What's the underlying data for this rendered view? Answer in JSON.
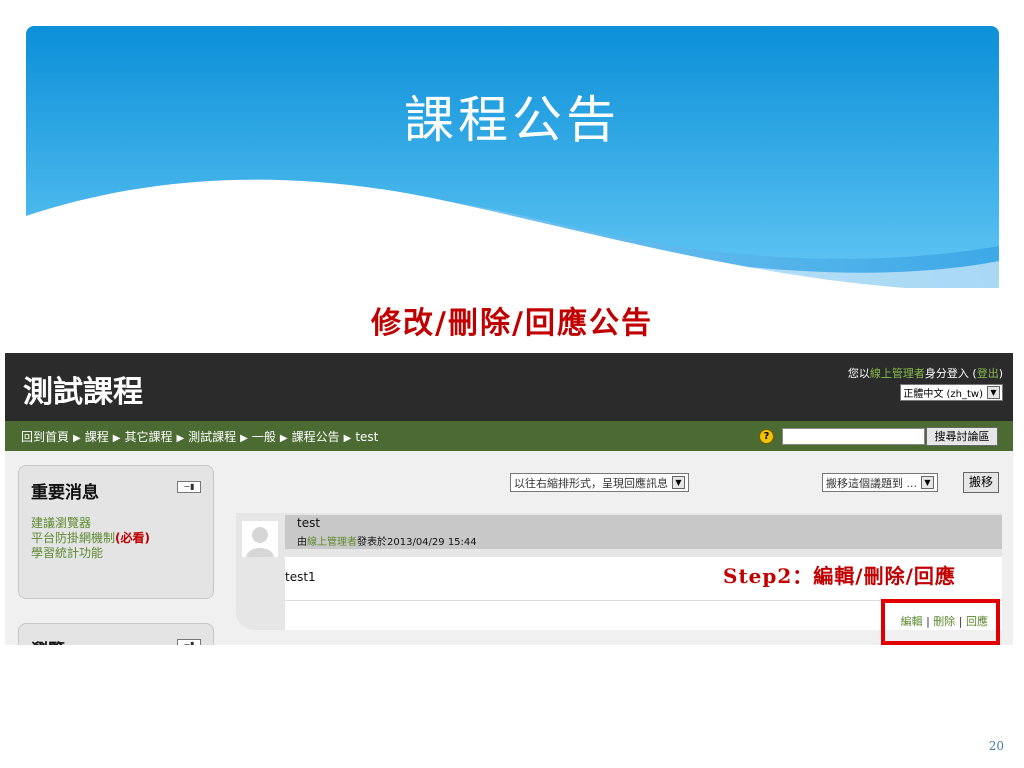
{
  "slide": {
    "title": "課程公告",
    "subtitle": "修改/刪除/回應公告",
    "page_number": "20"
  },
  "colors": {
    "banner_top": "#0b8fd8",
    "banner_bottom": "#5cc4f2",
    "header_bg": "#2b2b2b",
    "nav_bg": "#4b6b33",
    "link_green": "#5c8a2f",
    "accent_red": "#c00000"
  },
  "moodle": {
    "course_title": "測試課程",
    "login": {
      "prefix": "您以",
      "user": "線上管理者",
      "middle": "身分登入 (",
      "logout": "登出",
      "suffix": ")"
    },
    "language": "正體中文 (zh_tw)",
    "breadcrumb": [
      "回到首頁",
      "課程",
      "其它課程",
      "測試課程",
      "一般",
      "課程公告",
      "test"
    ],
    "search_button": "搜尋討論區",
    "blocks": [
      {
        "title": "重要消息",
        "links": [
          {
            "text": "建議瀏覽器"
          },
          {
            "text": "平台防掛網機制",
            "emphasis": "(必看)"
          },
          {
            "text": "學習統計功能"
          }
        ]
      },
      {
        "title": "瀏覽"
      }
    ],
    "sort_mode": "以往右縮排形式，呈現回應訊息",
    "move_select": "搬移這個議題到 ...",
    "move_button": "搬移",
    "post": {
      "subject": "test",
      "author_prefix": "由",
      "author": "線上管理者",
      "posted_label": "發表於",
      "date": "2013/04/29 15:44",
      "message": "test1",
      "actions": {
        "edit": "編輯",
        "delete": "刪除",
        "reply": "回應"
      }
    },
    "annotation": "Step2：編輯/刪除/回應"
  }
}
